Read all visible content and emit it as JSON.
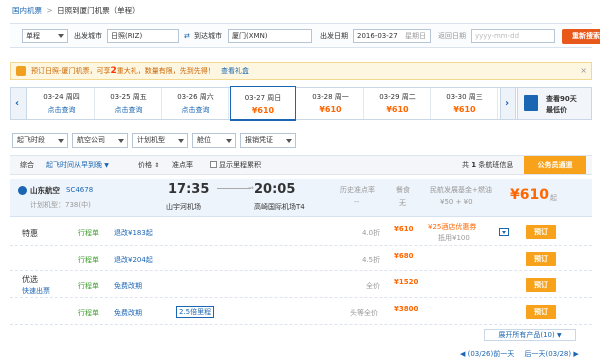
{
  "breadcrumb": {
    "home": "国内机票",
    "arrow": ">",
    "current": "日照到厦门机票（单程）"
  },
  "search": {
    "trip_type": "单程",
    "from_label": "出发城市",
    "from_value": "日照(RIZ)",
    "swap_label": "到达城市",
    "to_value": "厦门(XMN)",
    "depart_label": "出发日期",
    "depart_value": "2016-03-27",
    "depart_weekday": "星期日",
    "return_label": "返回日期",
    "return_placeholder": "yyyy-mm-dd",
    "submit": "重新搜索"
  },
  "promo": {
    "text_prefix": "预订日照-厦门机票，可享",
    "highlight": "2",
    "text_suffix": "重大礼，数量有限，先到先得！",
    "link": "查看礼盒"
  },
  "date_strip": {
    "days": [
      {
        "date": "03-24 周四",
        "price": "点击查询"
      },
      {
        "date": "03-25 周五",
        "price": "点击查询"
      },
      {
        "date": "03-26 周六",
        "price": "点击查询"
      },
      {
        "date": "03-27 周日",
        "price": "¥610"
      },
      {
        "date": "03-28 周一",
        "price": "¥610"
      },
      {
        "date": "03-29 周二",
        "price": "¥610"
      },
      {
        "date": "03-30 周三",
        "price": "¥610"
      }
    ],
    "calendar_line1": "查看90天",
    "calendar_line2": "最低价"
  },
  "filters": [
    "起飞时段",
    "航空公司",
    "计划机型",
    "舱位",
    "报销凭证"
  ],
  "sortbar": {
    "all": "综合",
    "depart_time": "起飞时间从早到晚",
    "price": "价格",
    "ontime": "准点率",
    "show_mileage": "显示里程累积",
    "total_prefix": "共",
    "total_count": "1",
    "total_suffix": "条航班信息",
    "member_channel": "公务员通道"
  },
  "flight": {
    "airline": "山东航空",
    "flight_no": "SC4678",
    "aircraft": "计划机型：738(中)",
    "dep_time": "17:35",
    "dep_airport": "山宇河机场",
    "arr_time": "20:05",
    "arr_airport": "高崎国际机场T4",
    "ontime_label": "历史准点率",
    "ontime_value": "--",
    "meal_label": "餐食",
    "meal_value": "无",
    "fee_label": "民航发展基金+燃油",
    "fee_value": "¥50 + ¥0",
    "lowest_price": "¥610",
    "price_suffix": "起"
  },
  "fares": [
    {
      "group": "特惠",
      "voucher": "行程单",
      "rule": "退改¥183起",
      "discount": "4.0折",
      "price": "¥610",
      "perk": "¥25酒店优惠券",
      "perk_sub": "抵用¥100",
      "book": "预订"
    },
    {
      "group": "",
      "voucher": "行程单",
      "rule": "退改¥204起",
      "discount": "4.5折",
      "price": "¥680",
      "book": "预订"
    },
    {
      "group": "优选",
      "group_sub": "快速出票",
      "voucher": "行程单",
      "rule": "免费改期",
      "discount": "全价",
      "price": "¥1520",
      "book": "预订"
    },
    {
      "group": "",
      "voucher": "行程单",
      "rule": "免费改期",
      "mileage": "2.5倍里程",
      "discount": "头等全价",
      "price": "¥3800",
      "book": "预订"
    }
  ],
  "expand": "展开所有产品(10)",
  "pager": {
    "prev": "(03/26)前一天",
    "next": "后一天(03/28)"
  },
  "colors": {
    "brand_blue": "#1a66b3",
    "price_orange": "#ff6600",
    "button_orange": "#f7a21a",
    "search_red": "#e8581b"
  }
}
